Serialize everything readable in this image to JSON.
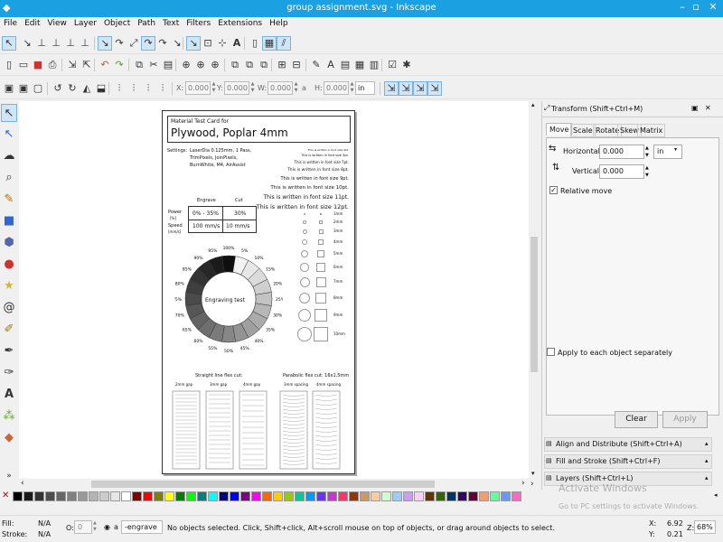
{
  "window": {
    "title": "group assignment.svg - Inkscape"
  },
  "menu": [
    "File",
    "Edit",
    "View",
    "Layer",
    "Object",
    "Path",
    "Text",
    "Filters",
    "Extensions",
    "Help"
  ],
  "controls": {
    "x_label": "X:",
    "x_value": "0.000",
    "y_label": "Y:",
    "y_value": "0.000",
    "w_label": "W:",
    "w_value": "0.000",
    "h_label": "H:",
    "h_value": "0.000",
    "unit": "in"
  },
  "card": {
    "header_small": "Material Test Card for",
    "header_big": "Plywood, Poplar 4mm",
    "settings_label": "Settings:",
    "settings_lines": [
      "LaserDia 0.125mm, 1 Pass,",
      "TrimPixels, JoinPixels,",
      "BurnWhite, M4, AirAssist"
    ],
    "font_samples": [
      "This is written in font size 4pt.",
      "This is written in font size 5pt.",
      "This is written in font size 7pt.",
      "This is written in font size 8pt.",
      "This is written in font size 9pt.",
      "This is written in font size 10pt.",
      "This is written in font size 11pt.",
      "This is written in font size 12pt."
    ],
    "table": {
      "col_engrave": "Engrave",
      "col_cut": "Cut",
      "power_label": "Power",
      "power_unit": "[%]",
      "speed_label": "Speed",
      "speed_unit": "[mm/s]",
      "power_engrave": "0% - 35%",
      "power_cut": "30%",
      "speed_engrave": "100 mm/s",
      "speed_cut": "10 mm/s"
    },
    "wheel_center": "Engraving test",
    "wheel_labels": [
      "100%",
      "5%",
      "10%",
      "15%",
      "20%",
      "25%",
      "30%",
      "35%",
      "40%",
      "45%",
      "50%",
      "55%",
      "60%",
      "65%",
      "70%",
      "75%",
      "80%",
      "85%",
      "90%",
      "95%"
    ],
    "sizes": [
      "1mm",
      "2mm",
      "3mm",
      "4mm",
      "5mm",
      "6mm",
      "7mm",
      "8mm",
      "9mm",
      "10mm"
    ],
    "flex_straight_title": "Straight line flex cut:",
    "flex_straight_gaps": [
      "2mm gap",
      "3mm gap",
      "4mm gap"
    ],
    "flex_parabolic_title": "Parabolic flex cut: 16x1,5mm",
    "flex_parabolic_spacing": [
      "3mm spacing",
      "4mm spacing"
    ]
  },
  "transform": {
    "title": "Transform (Shift+Ctrl+M)",
    "tabs": [
      "Move",
      "Scale",
      "Rotate",
      "Skew",
      "Matrix"
    ],
    "horizontal_label": "Horizontal:",
    "horizontal_value": "0.000",
    "vertical_label": "Vertical:",
    "vertical_value": "0.000",
    "unit": "in",
    "relative_move": "Relative move",
    "apply_each": "Apply to each object separately",
    "clear": "Clear",
    "apply": "Apply"
  },
  "panels": [
    "Align and Distribute (Shift+Ctrl+A)",
    "Fill and Stroke (Shift+Ctrl+F)",
    "Layers (Shift+Ctrl+L)"
  ],
  "watermark": {
    "line1": "Activate Windows",
    "line2": "Go to PC settings to activate Windows."
  },
  "status": {
    "fill_label": "Fill:",
    "fill_value": "N/A",
    "stroke_label": "Stroke:",
    "stroke_value": "N/A",
    "opacity_label": "O:",
    "opacity_value": "0",
    "layer": "-engrave",
    "message": "No objects selected. Click, Shift+click, Alt+scroll mouse on top of objects, or drag around objects to select.",
    "x_label": "X:",
    "x_value": "6.92",
    "y_label": "Y:",
    "y_value": "0.21",
    "z_label": "Z:",
    "zoom": "68%"
  },
  "palette_colors": [
    "#000000",
    "#1a1a1a",
    "#333333",
    "#4d4d4d",
    "#666666",
    "#808080",
    "#999999",
    "#b3b3b3",
    "#cccccc",
    "#e6e6e6",
    "#ffffff",
    "#800000",
    "#ff0000",
    "#808000",
    "#ffff00",
    "#008000",
    "#00ff00",
    "#008080",
    "#00ffff",
    "#000080",
    "#0000ff",
    "#800080",
    "#ff00ff",
    "#ff6600",
    "#ffcc00",
    "#99cc00",
    "#00cc99",
    "#0099ff",
    "#6633ff",
    "#cc33cc",
    "#ff3366",
    "#993300",
    "#cc9966",
    "#ffcc99",
    "#ccffcc",
    "#99ccff",
    "#cc99ff",
    "#ffccff",
    "#663300",
    "#336600",
    "#003366",
    "#330066",
    "#660033",
    "#ff9966",
    "#66ff99",
    "#6699ff",
    "#ff66cc"
  ]
}
